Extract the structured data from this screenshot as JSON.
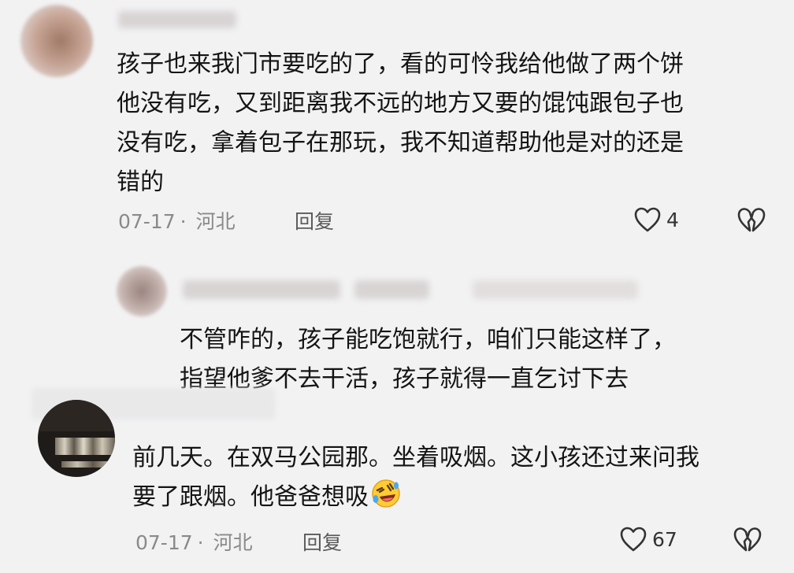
{
  "comments": [
    {
      "lines": [
        "孩子也来我门市要吃的了，看的可怜我给他做了两个饼",
        "他没有吃，又到距离我不远的地方又要的馄饨跟包子也",
        "没有吃，拿着包子在那玩，我不知道帮助他是对的还是",
        "错的"
      ],
      "date": "07-17",
      "separator": "·",
      "location": "河北",
      "reply_label": "回复",
      "likes": "4"
    },
    {
      "lines": [
        "不管咋的，孩子能吃饱就行，咱们只能这样了，",
        "指望他爹不去干活，孩子就得一直乞讨下去"
      ]
    },
    {
      "lines": [
        "前几天。在双马公园那。坐着吸烟。这小孩还过来问我",
        "要了跟烟。他爸爸想吸"
      ],
      "emoji": "rolling-on-floor-laughing-emoji",
      "date": "07-17",
      "separator": "·",
      "location": "河北",
      "reply_label": "回复",
      "likes": "67"
    }
  ],
  "icons": {
    "like": "heart-outline-icon",
    "dislike": "broken-heart-icon"
  },
  "colors": {
    "background": "#f2f2f3",
    "text": "#141414",
    "meta": "#8a8a8a"
  }
}
